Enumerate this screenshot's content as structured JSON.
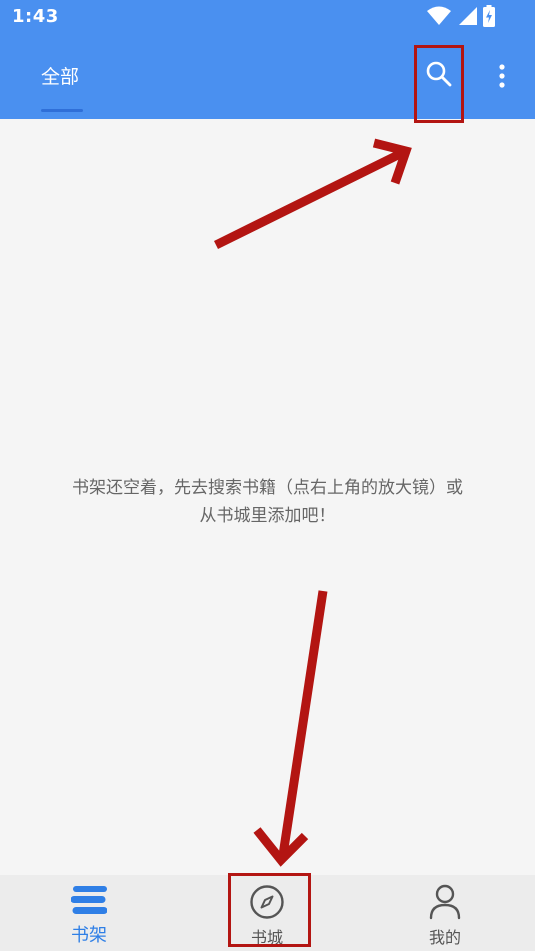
{
  "status_bar": {
    "time": "1:43",
    "icons": [
      "wifi-icon",
      "signal-icon",
      "battery-charging-icon"
    ]
  },
  "app_bar": {
    "tab_label": "全部",
    "search_icon": "search-icon",
    "more_icon": "more-vertical-icon"
  },
  "empty_state": {
    "line1": "书架还空着，先去搜索书籍（点右上角的放大镜）或",
    "line2": "从书城里添加吧！"
  },
  "bottom_nav": {
    "items": [
      {
        "label": "书架",
        "icon": "bookshelf-icon",
        "active": true
      },
      {
        "label": "书城",
        "icon": "compass-icon",
        "active": false
      },
      {
        "label": "我的",
        "icon": "person-icon",
        "active": false
      }
    ]
  },
  "colors": {
    "primary": "#4a90f0",
    "active": "#2f7fe6",
    "annotation": "#b31512",
    "background": "#f5f5f5"
  },
  "annotations": {
    "highlight_boxes": [
      "search-button",
      "nav-bookstore"
    ],
    "arrows": 2
  }
}
